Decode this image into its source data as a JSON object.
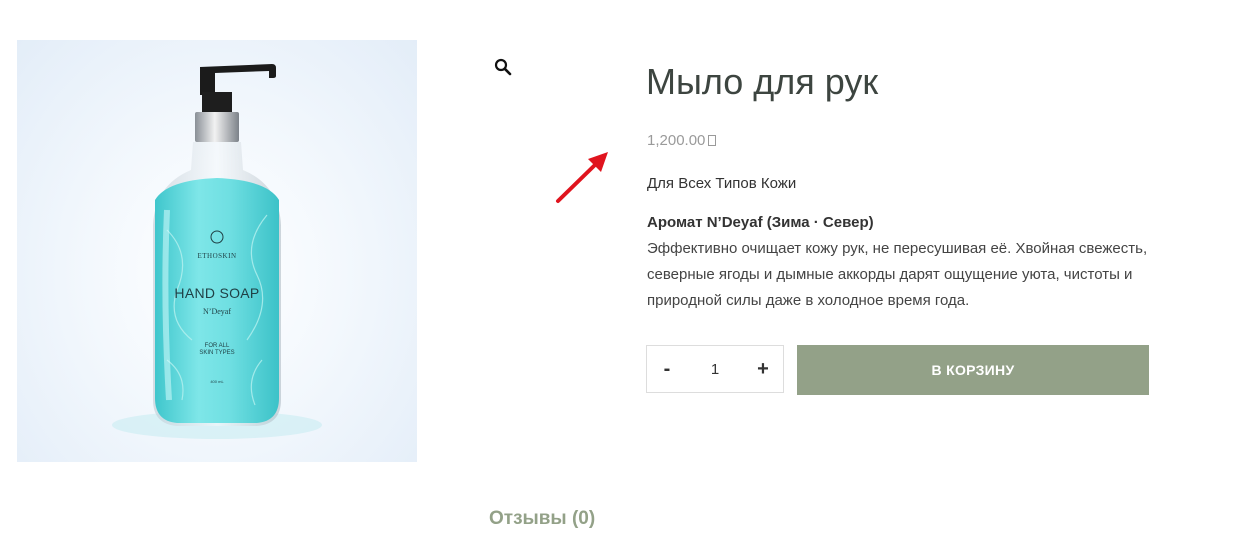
{
  "product": {
    "title": "Мыло для рук",
    "price": "1,200.00",
    "subtitle": "Для Всех Типов Кожи",
    "aroma_title": "Аромат N’Deyaf (Зима · Север)",
    "description": "Эффективно очищает кожу рук, не пересушивая её. Хвойная свежесть, северные ягоды и дымные аккорды дарят ощущение уюта, чистоты и природной силы даже в холодное время года."
  },
  "bottle_label": {
    "brand": "ETHOSKIN",
    "product": "HAND SOAP",
    "scent": "N’Deyaf",
    "skin": "FOR ALL\nSKIN TYPES",
    "volume": "400 mL"
  },
  "quantity": {
    "minus_label": "-",
    "value": "1",
    "plus_label": "+"
  },
  "cart": {
    "add_label": "В КОРЗИНУ"
  },
  "tabs": {
    "reviews_label": "Отзывы (0)"
  },
  "icons": {
    "zoom": "magnifier-icon",
    "arrow": "red-arrow-annotation",
    "currency": "missing-glyph-box"
  },
  "colors": {
    "accent": "#93a188",
    "title": "#3d4540",
    "price": "#9a9a9a",
    "arrow": "#e0141e",
    "bottle_liquid": "#5ed6db"
  }
}
